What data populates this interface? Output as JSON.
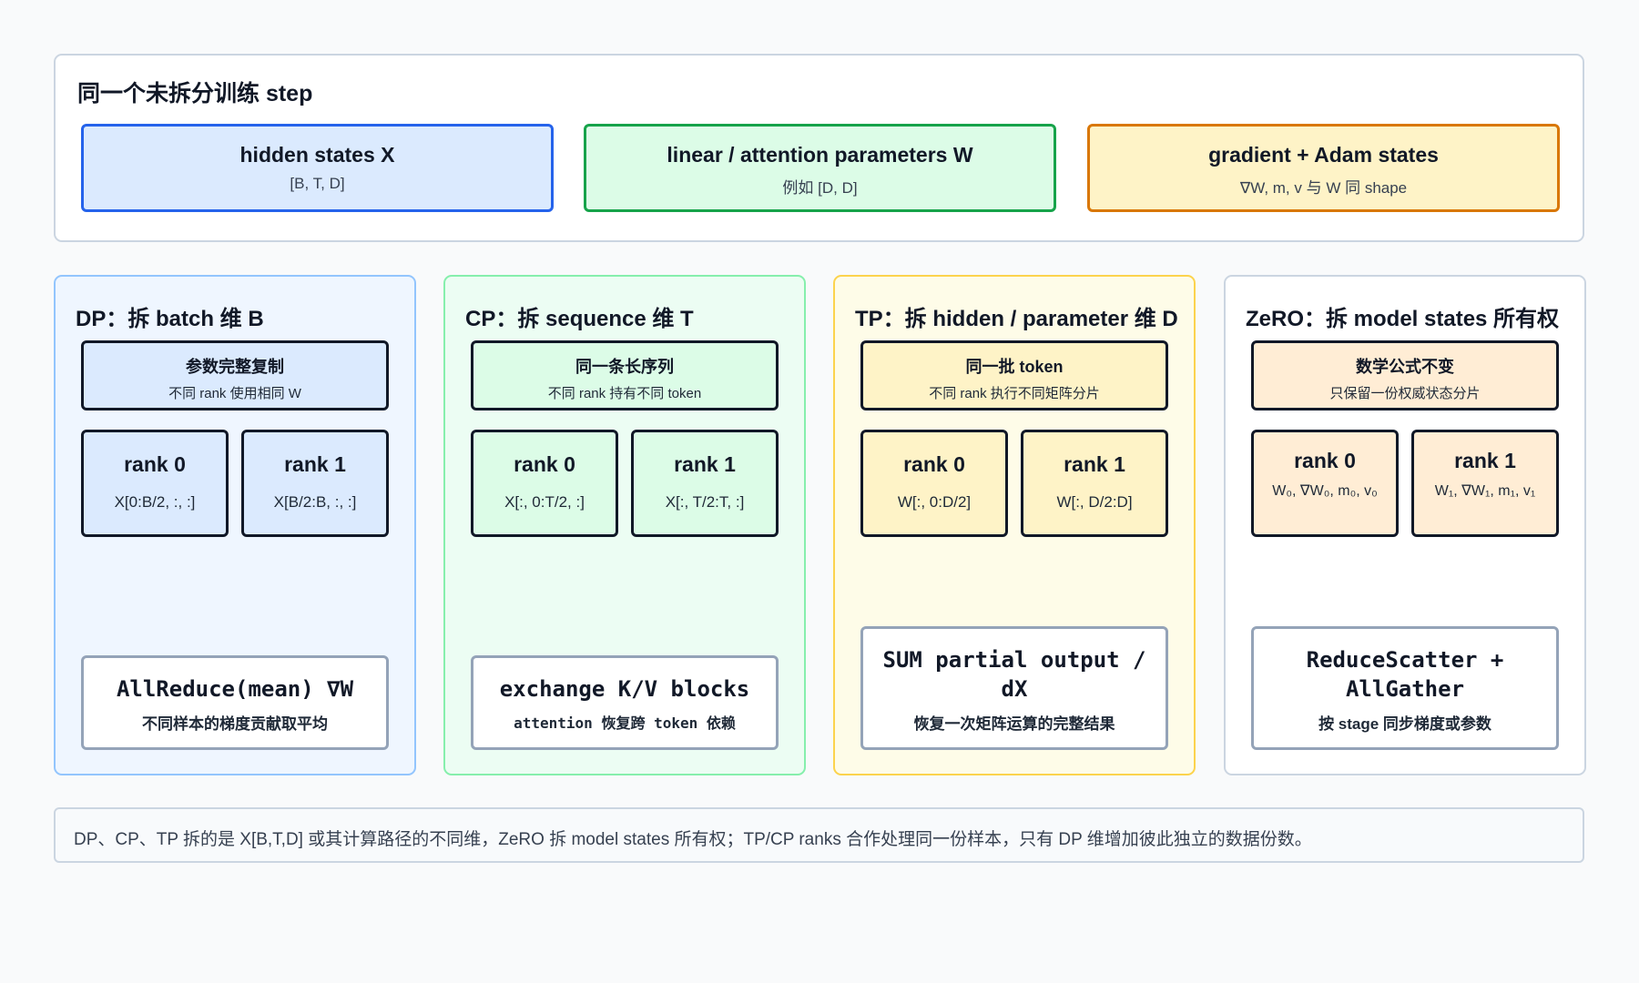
{
  "top": {
    "title": "同一个未拆分训练 step",
    "boxes": [
      {
        "title": "hidden states X",
        "sub": "[B, T, D]"
      },
      {
        "title": "linear / attention parameters W",
        "sub": "例如 [D, D]"
      },
      {
        "title": "gradient + Adam states",
        "sub": "∇W, m, v 与 W 同 shape"
      }
    ]
  },
  "columns": {
    "dp": {
      "title": "DP：拆 batch 维 B",
      "box_title": "参数完整复制",
      "box_sub": "不同 rank 使用相同 W",
      "rank0_title": "rank 0",
      "rank0_sub": "X[0:B/2, :, :]",
      "rank1_title": "rank 1",
      "rank1_sub": "X[B/2:B, :, :]",
      "comm_title": "AllReduce(mean) ∇W",
      "comm_sub": "不同样本的梯度贡献取平均"
    },
    "cp": {
      "title": "CP：拆 sequence 维 T",
      "box_title": "同一条长序列",
      "box_sub": "不同 rank 持有不同 token",
      "rank0_title": "rank 0",
      "rank0_sub": "X[:, 0:T/2, :]",
      "rank1_title": "rank 1",
      "rank1_sub": "X[:, T/2:T, :]",
      "comm_title": "exchange K/V blocks",
      "comm_sub": "attention 恢复跨 token 依赖"
    },
    "tp": {
      "title": "TP：拆 hidden / parameter 维 D",
      "box_title": "同一批 token",
      "box_sub": "不同 rank 执行不同矩阵分片",
      "rank0_title": "rank 0",
      "rank0_sub": "W[:, 0:D/2]",
      "rank1_title": "rank 1",
      "rank1_sub": "W[:, D/2:D]",
      "comm_title": "SUM partial output / dX",
      "comm_sub": "恢复一次矩阵运算的完整结果"
    },
    "zero": {
      "title": "ZeRO：拆 model states 所有权",
      "box_title": "数学公式不变",
      "box_sub": "只保留一份权威状态分片",
      "rank0_title": "rank 0",
      "rank0_sub": "W₀, ∇W₀, m₀, v₀",
      "rank1_title": "rank 1",
      "rank1_sub": "W₁, ∇W₁, m₁, v₁",
      "comm_title": "ReduceScatter + AllGather",
      "comm_sub": "按 stage 同步梯度或参数"
    }
  },
  "note": "DP、CP、TP 拆的是 X[B,T,D] 或其计算路径的不同维，ZeRO 拆 model states 所有权；TP/CP ranks 合作处理同一份样本，只有 DP 维增加彼此独立的数据份数。",
  "colors": {
    "blue": "#2563eb",
    "green": "#16a34a",
    "yellow": "#d97706",
    "orange": "#ea580c",
    "gray": "#94a3b8"
  }
}
